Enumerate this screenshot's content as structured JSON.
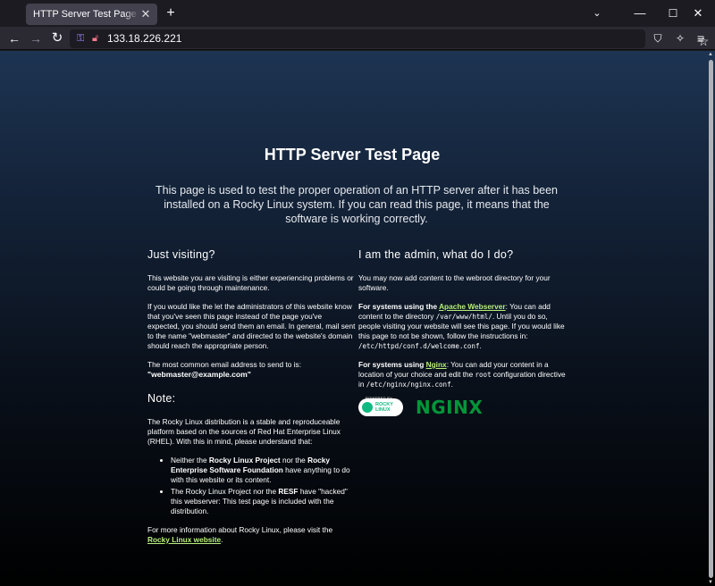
{
  "browser": {
    "tab_title": "HTTP Server Test Page powered by: Rocky Linux",
    "new_tab": "+",
    "url": "133.18.226.221"
  },
  "page": {
    "title": "HTTP Server Test Page",
    "intro": "This page is used to test the proper operation of an HTTP server after it has been installed on a Rocky Linux system. If you can read this page, it means that the software is working correctly.",
    "left": {
      "heading": "Just visiting?",
      "p1": "This website you are visiting is either experiencing problems or could be going through maintenance.",
      "p2": "If you would like the let the administrators of this website know that you've seen this page instead of the page you've expected, you should send them an email. In general, mail sent to the name \"webmaster\" and directed to the website's domain should reach the appropriate person.",
      "p3": "The most common email address to send to is:",
      "email": "\"webmaster@example.com\"",
      "note_heading": "Note:",
      "note_p": "The Rocky Linux distribution is a stable and reproduceable platform based on the sources of Red Hat Enterprise Linux (RHEL). With this in mind, please understand that:",
      "li1_a": "Neither the ",
      "li1_b1": "Rocky Linux Project",
      "li1_c": " nor the ",
      "li1_b2": "Rocky Enterprise Software Foundation",
      "li1_d": " have anything to do with this website or its content.",
      "li2_a": "The Rocky Linux Project nor the ",
      "li2_b": "RESF",
      "li2_c": " have \"hacked\" this webserver: This test page is included with the distribution.",
      "more_a": "For more information about Rocky Linux, please visit the ",
      "more_link": "Rocky Linux website",
      "more_end": "."
    },
    "right": {
      "heading": "I am the admin, what do I do?",
      "p1": "You may now add content to the webroot directory for your software.",
      "apache_b": "For systems using the ",
      "apache_link": "Apache Webserver",
      "apache_a": ": You can add content to the directory ",
      "apache_code1": "/var/www/html/",
      "apache_b2": ". Until you do so, people visiting your website will see this page. If you would like this page to not be shown, follow the instructions in: ",
      "apache_code2": "/etc/httpd/conf.d/welcome.conf",
      "apache_end": ".",
      "nginx_b": "For systems using ",
      "nginx_link": "Nginx",
      "nginx_a": ": You can add your content in a location of your choice and edit the ",
      "nginx_code1": "root",
      "nginx_b2": " configuration directive in ",
      "nginx_code2": "/etc/nginx/nginx.conf",
      "nginx_end": "."
    },
    "logos": {
      "rocky_powered": "POWERED BY",
      "rocky_line1": "ROCKY",
      "rocky_line2": "LINUX",
      "nginx": "NGINX"
    }
  },
  "colors": {
    "link": "#b7ef7a",
    "nginx_green": "#009639",
    "rocky_green": "#10b981"
  }
}
